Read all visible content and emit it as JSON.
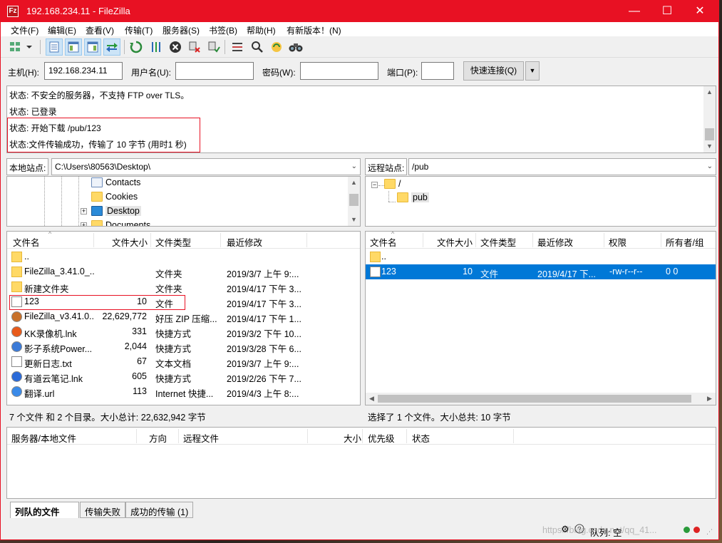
{
  "title": "192.168.234.11 - FileZilla",
  "menu": [
    "文件(F)",
    "编辑(E)",
    "查看(V)",
    "传输(T)",
    "服务器(S)",
    "书签(B)",
    "帮助(H)",
    "有新版本！(N)"
  ],
  "quickconnect": {
    "host_label": "主机(H):",
    "host_value": "192.168.234.11",
    "user_label": "用户名(U):",
    "user_value": "",
    "pass_label": "密码(W):",
    "pass_value": "",
    "port_label": "端口(P):",
    "port_value": "",
    "button": "快速连接(Q)"
  },
  "log": [
    "状态: 不安全的服务器，不支持 FTP over TLS。",
    "状态: 已登录",
    "状态: 开始下载 /pub/123",
    "状态:文件传输成功，传输了 10 字节 (用时1 秒)"
  ],
  "local": {
    "label": "本地站点:",
    "path": "C:\\Users\\80563\\Desktop\\",
    "tree": [
      "Contacts",
      "Cookies",
      "Desktop",
      "Documents"
    ],
    "headers": [
      "文件名",
      "文件大小",
      "文件类型",
      "最近修改"
    ],
    "files": [
      {
        "name": "..",
        "size": "",
        "type": "",
        "date": "",
        "icon": "folder-icon"
      },
      {
        "name": "FileZilla_3.41.0_...",
        "size": "",
        "type": "文件夹",
        "date": "2019/3/7 上午 9:...",
        "icon": "folder-icon"
      },
      {
        "name": "新建文件夹",
        "size": "",
        "type": "文件夹",
        "date": "2019/4/17 下午 3...",
        "icon": "folder-icon"
      },
      {
        "name": "123",
        "size": "10",
        "type": "文件",
        "date": "2019/4/17 下午 3...",
        "icon": "file-icon"
      },
      {
        "name": "FileZilla_v3.41.0...",
        "size": "22,629,772",
        "type": "好压 ZIP 压缩...",
        "date": "2019/4/17 下午 1...",
        "icon": "zip-icon"
      },
      {
        "name": "KK录像机.lnk",
        "size": "331",
        "type": "快捷方式",
        "date": "2019/3/2 下午 10...",
        "icon": "kk-recorder-icon"
      },
      {
        "name": "影子系统Power...",
        "size": "2,044",
        "type": "快捷方式",
        "date": "2019/3/28 下午 6...",
        "icon": "shadow-system-icon"
      },
      {
        "name": "更新日志.txt",
        "size": "67",
        "type": "文本文档",
        "date": "2019/3/7 上午 9:...",
        "icon": "text-file-icon"
      },
      {
        "name": "有道云笔记.lnk",
        "size": "605",
        "type": "快捷方式",
        "date": "2019/2/26 下午 7...",
        "icon": "youdao-note-icon"
      },
      {
        "name": "翻译.url",
        "size": "113",
        "type": "Internet 快捷...",
        "date": "2019/4/3 上午 8:...",
        "icon": "url-icon"
      }
    ],
    "status": "7 个文件 和 2 个目录。大小总计: 22,632,942 字节"
  },
  "remote": {
    "label": "远程站点:",
    "path": "/pub",
    "tree": [
      "/",
      "pub"
    ],
    "headers": [
      "文件名",
      "文件大小",
      "文件类型",
      "最近修改",
      "权限",
      "所有者/组"
    ],
    "files": [
      {
        "name": "..",
        "size": "",
        "type": "",
        "date": "",
        "perm": "",
        "owner": ""
      },
      {
        "name": "123",
        "size": "10",
        "type": "文件",
        "date": "2019/4/17 下...",
        "perm": "-rw-r--r--",
        "owner": "0 0"
      }
    ],
    "status": "选择了 1 个文件。大小总共: 10 字节"
  },
  "queue": {
    "headers": [
      "服务器/本地文件",
      "方向",
      "远程文件",
      "大小",
      "优先级",
      "状态"
    ],
    "tabs": [
      "列队的文件",
      "传输失败",
      "成功的传输 (1)"
    ]
  },
  "statusbar": {
    "queue": "队列: 空"
  },
  "watermark": "https://blog.csdn.net/qq_41..."
}
